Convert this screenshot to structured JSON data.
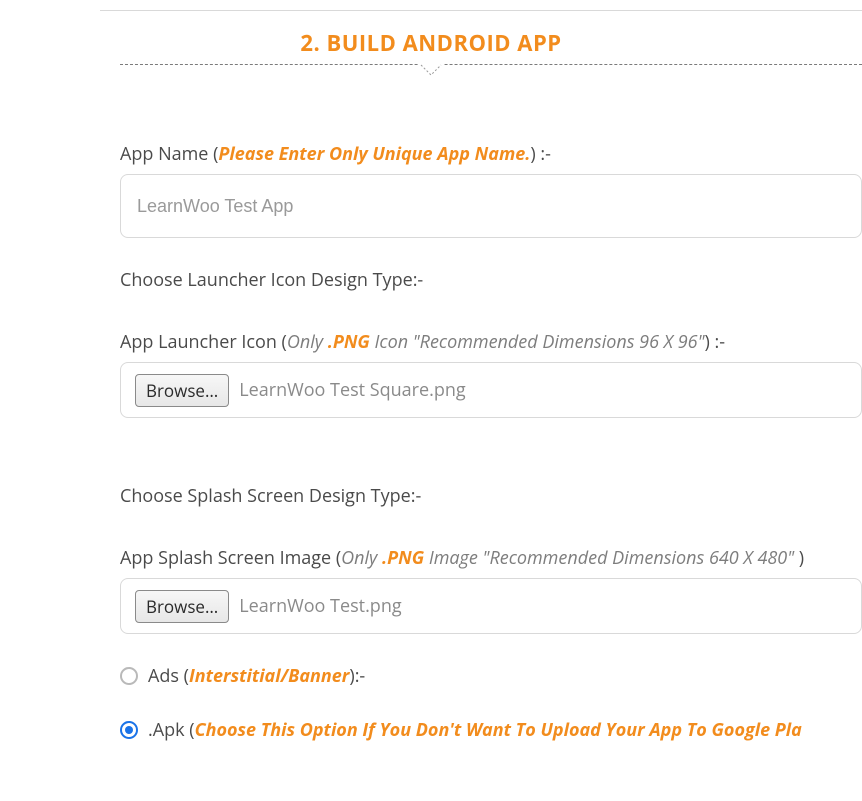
{
  "section": {
    "title": "2. BUILD ANDROID APP"
  },
  "appName": {
    "label_prefix": "App Name (",
    "hint": "Please Enter Only Unique App Name.",
    "label_suffix": ") :-",
    "placeholder": "LearnWoo Test App"
  },
  "launcherType": {
    "label": "Choose Launcher Icon Design Type:-"
  },
  "launcherIcon": {
    "label_prefix": "App Launcher Icon (",
    "hint_only": "Only ",
    "hint_png": ".PNG",
    "hint_rest": " Icon \"Recommended Dimensions 96 X 96\"",
    "label_suffix": ") :-",
    "browse": "Browse…",
    "filename": "LearnWoo Test Square.png"
  },
  "splashType": {
    "label": "Choose Splash Screen Design Type:-"
  },
  "splashImage": {
    "label_prefix": "App Splash Screen Image (",
    "hint_only": "Only ",
    "hint_png": ".PNG",
    "hint_rest": " Image \"Recommended Dimensions 640 X 480\" ",
    "label_suffix": ")",
    "browse": "Browse…",
    "filename": "LearnWoo Test.png"
  },
  "ads": {
    "prefix": "Ads (",
    "hint": "Interstitial/Banner",
    "suffix": "):-",
    "checked": false
  },
  "apk": {
    "prefix": ".Apk (",
    "hint": "Choose This Option If You Don't Want To Upload Your App To Google Pla",
    "checked": true
  }
}
